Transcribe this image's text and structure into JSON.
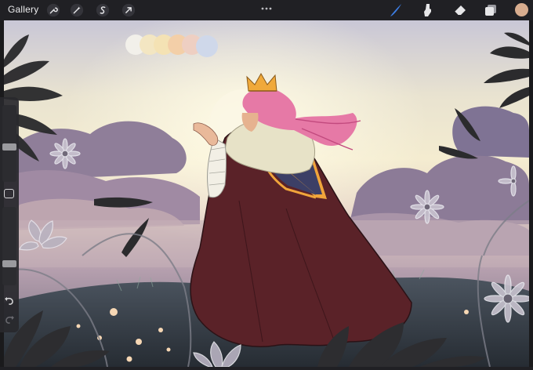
{
  "toolbar": {
    "gallery_label": "Gallery",
    "left_tools": [
      {
        "icon": "wrench-icon"
      },
      {
        "icon": "magic-wand-icon"
      },
      {
        "icon": "selection-s-icon"
      },
      {
        "icon": "transform-arrow-icon"
      }
    ],
    "right_tools": [
      {
        "icon": "brush-icon"
      },
      {
        "icon": "smudge-icon"
      },
      {
        "icon": "eraser-icon"
      },
      {
        "icon": "layers-icon"
      }
    ],
    "current_color": "#d8ad8f",
    "brush_accent": "#3d7fe6"
  },
  "sidebar": {
    "brush_size_level": 0.45,
    "opacity_level": 0.25,
    "undo_icon": "undo-arrow-icon",
    "redo_icon": "redo-arrow-icon"
  },
  "palette": [
    "#f2f0ea",
    "#f3e6c2",
    "#f4e2b4",
    "#f3cfa8",
    "#eecfc2",
    "#cfd8ea"
  ]
}
